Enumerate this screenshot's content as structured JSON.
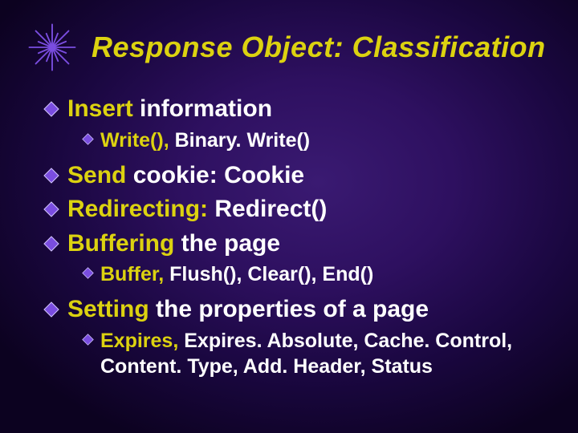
{
  "title": "Response Object: Classification",
  "items": [
    {
      "level": 1,
      "segments": [
        {
          "text": "Insert ",
          "hl": true
        },
        {
          "text": "information",
          "hl": false
        }
      ]
    },
    {
      "level": 2,
      "segments": [
        {
          "text": "Write(), ",
          "hl": true
        },
        {
          "text": "Binary. Write()",
          "hl": false
        }
      ]
    },
    {
      "level": 1,
      "segments": [
        {
          "text": "Send ",
          "hl": true
        },
        {
          "text": "cookie: ",
          "hl": false
        },
        {
          "text": "Cookie",
          "hl": false
        }
      ]
    },
    {
      "level": 1,
      "segments": [
        {
          "text": "Redirecting: ",
          "hl": true
        },
        {
          "text": "Redirect()",
          "hl": false
        }
      ]
    },
    {
      "level": 1,
      "segments": [
        {
          "text": "Buffering ",
          "hl": true
        },
        {
          "text": "the page",
          "hl": false
        }
      ]
    },
    {
      "level": 2,
      "segments": [
        {
          "text": "Buffer, ",
          "hl": true
        },
        {
          "text": "Flush(), Clear(), End()",
          "hl": false
        }
      ]
    },
    {
      "level": 1,
      "segments": [
        {
          "text": "Setting ",
          "hl": true
        },
        {
          "text": "the properties of a page",
          "hl": false
        }
      ]
    },
    {
      "level": 2,
      "segments": [
        {
          "text": "Expires, ",
          "hl": true
        },
        {
          "text": "Expires. Absolute, Cache. Control, Content. Type, Add. Header, Status",
          "hl": false
        }
      ]
    }
  ]
}
